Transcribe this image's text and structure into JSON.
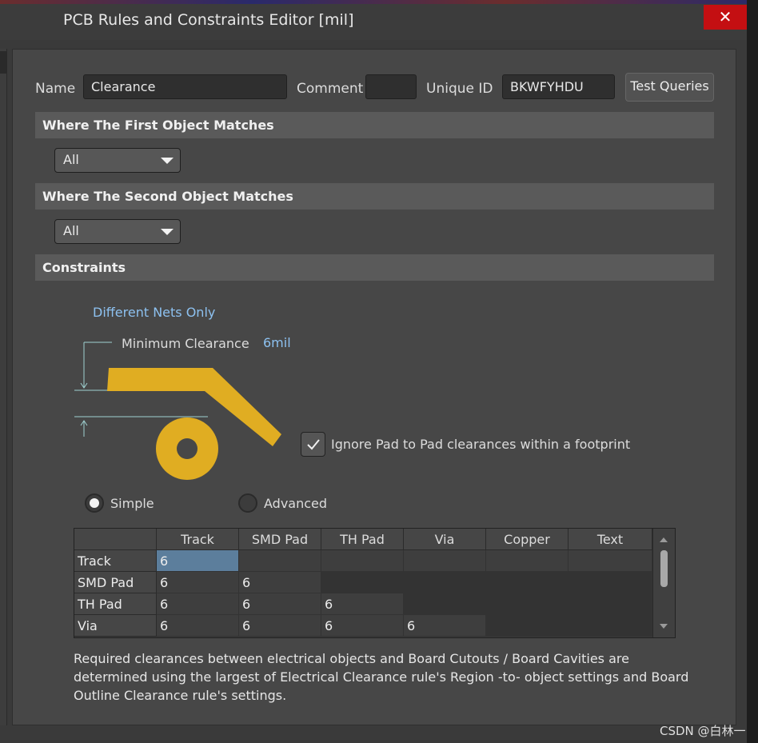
{
  "window": {
    "title": "PCB Rules and Constraints Editor [mil]",
    "close_glyph": "✕"
  },
  "rule": {
    "name_label": "Name",
    "name_value": "Clearance",
    "comment_label": "Comment",
    "comment_value": "",
    "uid_label": "Unique ID",
    "uid_value": "BKWFYHDU",
    "test_queries_label": "Test Queries"
  },
  "first_object": {
    "header": "Where The First Object Matches",
    "selected": "All"
  },
  "second_object": {
    "header": "Where The Second Object Matches",
    "selected": "All"
  },
  "constraints": {
    "header": "Constraints",
    "net_scope": "Different Nets Only",
    "min_clearance_label": "Minimum Clearance",
    "min_clearance_value": "6mil",
    "ignore_pad_label": "Ignore Pad to Pad clearances within a footprint",
    "ignore_pad_checked": true,
    "mode_simple": "Simple",
    "mode_advanced": "Advanced",
    "mode_selected": "Simple"
  },
  "matrix": {
    "columns": [
      "Track",
      "SMD Pad",
      "TH Pad",
      "Via",
      "Copper",
      "Text"
    ],
    "rows": [
      {
        "label": "Track",
        "values": [
          "6",
          "",
          "",
          "",
          "",
          ""
        ]
      },
      {
        "label": "SMD Pad",
        "values": [
          "6",
          "6"
        ]
      },
      {
        "label": "TH Pad",
        "values": [
          "6",
          "6",
          "6"
        ]
      },
      {
        "label": "Via",
        "values": [
          "6",
          "6",
          "6",
          "6"
        ]
      }
    ]
  },
  "description": "Required clearances between electrical objects and Board Cutouts / Board Cavities are determined using the largest of Electrical Clearance rule's Region -to- object settings and Board Outline Clearance rule's settings.",
  "watermark": "CSDN @白林一",
  "colors": {
    "copper": "#e0ad22",
    "link": "#8dc1f0",
    "close": "#c40f12"
  }
}
